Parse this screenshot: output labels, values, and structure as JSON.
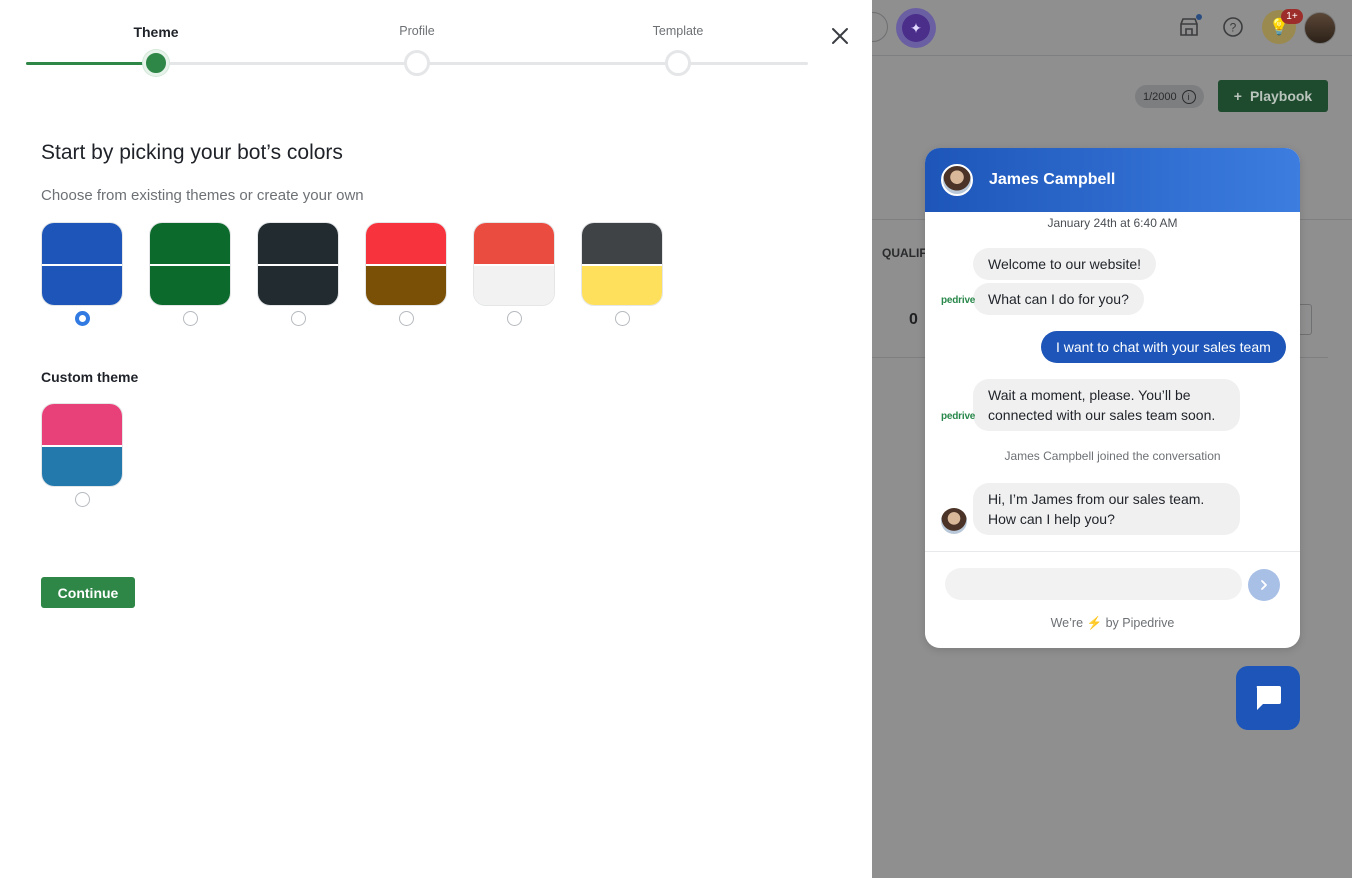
{
  "stepper": {
    "steps": [
      {
        "label": "Theme",
        "state": "active"
      },
      {
        "label": "Profile",
        "state": "pending"
      },
      {
        "label": "Template",
        "state": "pending"
      }
    ]
  },
  "main": {
    "heading": "Start by picking your bot’s colors",
    "subheading": "Choose from existing themes or create your own",
    "themes": [
      {
        "top": "#1d56b8",
        "bottom": "#1d56b8",
        "selected": true
      },
      {
        "top": "#0c6b2c",
        "bottom": "#0c6b2c",
        "selected": false
      },
      {
        "top": "#222c30",
        "bottom": "#222c30",
        "selected": false
      },
      {
        "top": "#f7333d",
        "bottom": "#7a4f06",
        "selected": false
      },
      {
        "top": "#ea4c40",
        "bottom": "#f2f2f2",
        "selected": false
      },
      {
        "top": "#404346",
        "bottom": "#ffe05d",
        "selected": false
      }
    ],
    "custom_title": "Custom theme",
    "custom_theme": {
      "top": "#e84079",
      "bottom": "#2479ac",
      "selected": false
    },
    "continue_label": "Continue"
  },
  "chat": {
    "agent_name": "James Campbell",
    "date": "January 24th at 6:40 AM",
    "brand_logo": "pedrive",
    "messages": [
      {
        "from": "bot",
        "text": "Welcome to our website!"
      },
      {
        "from": "bot",
        "text": "What can I do for you?"
      },
      {
        "from": "user",
        "text": "I want to chat with your sales team"
      },
      {
        "from": "bot",
        "text": "Wait a moment, please. You’ll be connected with our sales team soon."
      },
      {
        "from": "system",
        "text": "James Campbell joined the conversation"
      },
      {
        "from": "agent",
        "text": "Hi, I’m James from our sales team. How can I help you?"
      }
    ],
    "powered_prefix": "We’re",
    "powered_suffix": "by Pipedrive"
  },
  "background": {
    "counter": "1/2000",
    "playbook_label": "Playbook",
    "column_label": "QUALIF",
    "column_value": "0",
    "notification_badge": "1+"
  }
}
